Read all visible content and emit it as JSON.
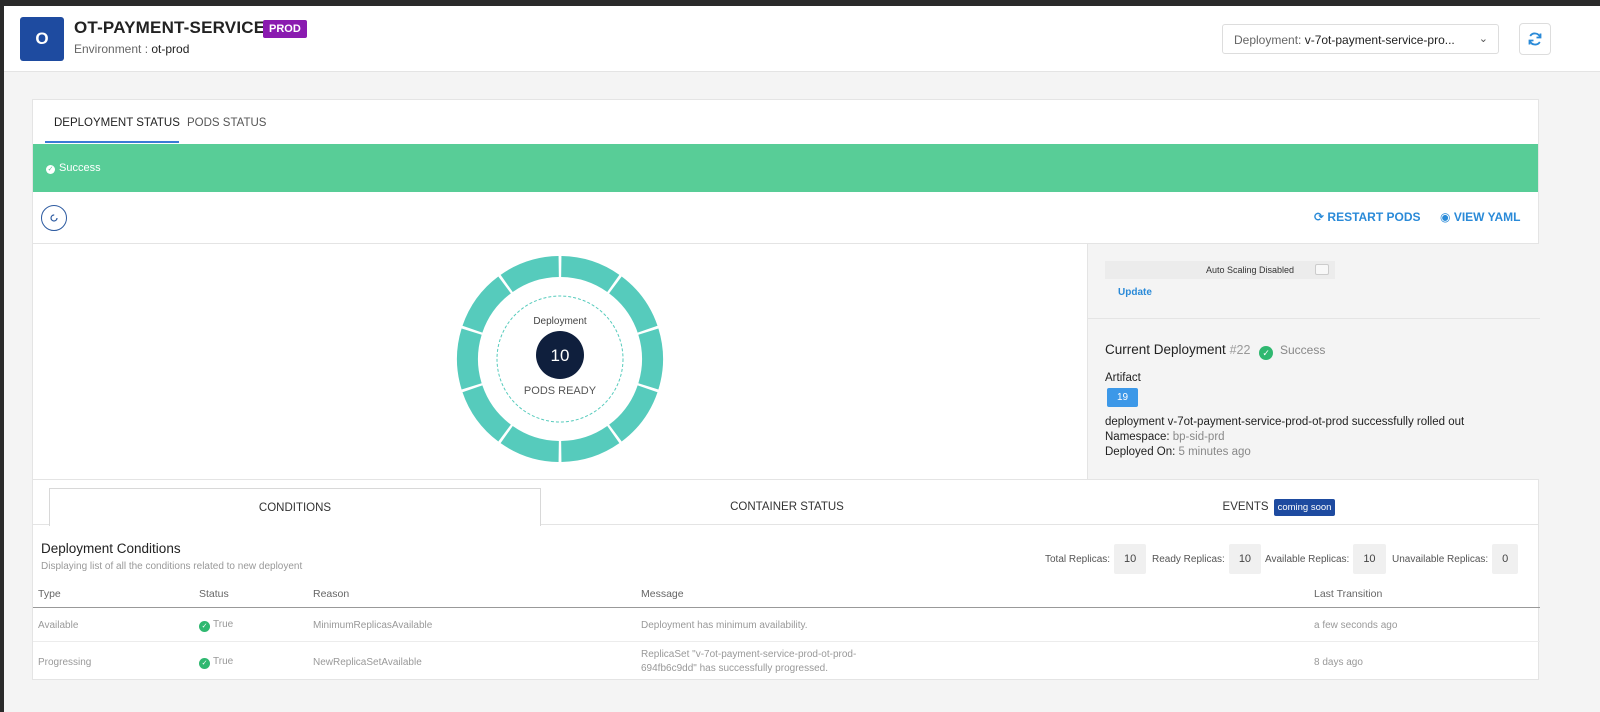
{
  "header": {
    "avatar_letter": "O",
    "service_name": "OT-PAYMENT-SERVICE",
    "env_badge": "PROD",
    "environment_label": "Environment : ",
    "environment_value": "ot-prod",
    "deployment_label": "Deployment: ",
    "deployment_value": "v-7ot-payment-service-pro..."
  },
  "tabs": [
    "DEPLOYMENT STATUS",
    "PODS STATUS"
  ],
  "status_bar": "Success",
  "actions": {
    "restart": "RESTART PODS",
    "yaml": "VIEW YAML"
  },
  "pods": {
    "label": "Deployment",
    "count": "10",
    "caption": "PODS READY",
    "ring_color": "#56cbbc"
  },
  "autoscaling": {
    "label": "Auto Scaling Disabled",
    "update": "Update"
  },
  "current_deployment": {
    "title": "Current Deployment",
    "number": "#22",
    "status": "Success",
    "artifact_label": "Artifact",
    "artifact": "19",
    "message": "deployment v-7ot-payment-service-prod-ot-prod successfully rolled out",
    "namespace_label": "Namespace: ",
    "namespace": "bp-sid-prd",
    "deployed_label": "Deployed On: ",
    "deployed": "5 minutes ago"
  },
  "sub_tabs": {
    "conditions": "CONDITIONS",
    "container": "CONTAINER STATUS",
    "events": "EVENTS",
    "events_badge": "coming soon"
  },
  "conditions": {
    "title": "Deployment Conditions",
    "subtitle": "Displaying list of all the conditions related to new deployent",
    "replicas": [
      {
        "label": "Total Replicas:",
        "value": "10"
      },
      {
        "label": "Ready Replicas:",
        "value": "10"
      },
      {
        "label": "Available Replicas:",
        "value": "10"
      },
      {
        "label": "Unavailable Replicas:",
        "value": "0"
      }
    ],
    "columns": [
      "Type",
      "Status",
      "Reason",
      "Message",
      "Last Transition"
    ],
    "rows": [
      {
        "type": "Available",
        "status": "True",
        "reason": "MinimumReplicasAvailable",
        "message": "Deployment has minimum availability.",
        "message2": "",
        "last": "a few seconds ago"
      },
      {
        "type": "Progressing",
        "status": "True",
        "reason": "NewReplicaSetAvailable",
        "message": "ReplicaSet \"v-7ot-payment-service-prod-ot-prod-",
        "message2": "694fb6c9dd\" has successfully progressed.",
        "last": "8 days ago"
      }
    ]
  },
  "colors": {
    "success_bar": "#58cd97",
    "accent_link": "#2a8ad8",
    "avatar": "#1e4ba0",
    "prod_badge": "#8a1bb0"
  }
}
